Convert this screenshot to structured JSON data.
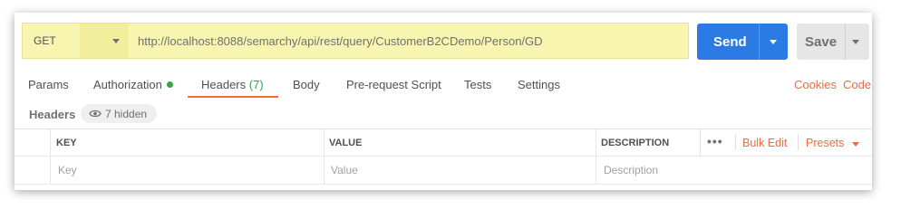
{
  "request": {
    "method": "GET",
    "url": "http://localhost:8088/semarchy/api/rest/query/CustomerB2CDemo/Person/GD",
    "send_label": "Send",
    "save_label": "Save"
  },
  "tabs": [
    {
      "label": "Params"
    },
    {
      "label": "Authorization"
    },
    {
      "label": "Headers",
      "count": "(7)",
      "active": true
    },
    {
      "label": "Body"
    },
    {
      "label": "Pre-request Script"
    },
    {
      "label": "Tests"
    },
    {
      "label": "Settings"
    }
  ],
  "links": {
    "cookies": "Cookies",
    "code": "Code"
  },
  "headers_section": {
    "title": "Headers",
    "hidden_label": "7 hidden"
  },
  "table": {
    "columns": {
      "key": "KEY",
      "value": "VALUE",
      "description": "DESCRIPTION"
    },
    "placeholders": {
      "key": "Key",
      "value": "Value",
      "description": "Description"
    },
    "more_label": "•••",
    "bulk_edit": "Bulk Edit",
    "presets": "Presets"
  },
  "colors": {
    "accent": "#f26b3a",
    "primary": "#2c7be5",
    "highlight": "#f8f5b0",
    "success": "#3aa04a"
  }
}
